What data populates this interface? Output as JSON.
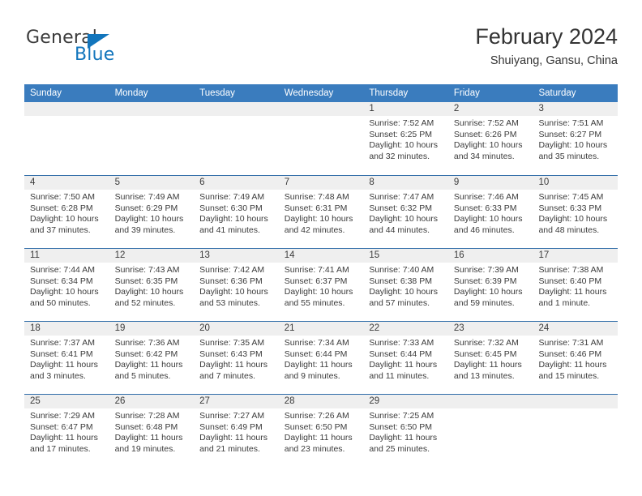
{
  "brand": {
    "name_top": "General",
    "name_bottom": "Blue",
    "accent_color": "#1275bc"
  },
  "header": {
    "title": "February 2024",
    "subtitle": "Shuiyang, Gansu, China"
  },
  "calendar": {
    "header_bg": "#3a7cbe",
    "row_divider_color": "#2f6ca8",
    "date_band_bg": "#efefef",
    "weekday_names": [
      "Sunday",
      "Monday",
      "Tuesday",
      "Wednesday",
      "Thursday",
      "Friday",
      "Saturday"
    ],
    "weeks": [
      [
        {
          "empty": true
        },
        {
          "empty": true
        },
        {
          "empty": true
        },
        {
          "empty": true
        },
        {
          "day": "1",
          "sunrise": "Sunrise: 7:52 AM",
          "sunset": "Sunset: 6:25 PM",
          "daylight": "Daylight: 10 hours and 32 minutes."
        },
        {
          "day": "2",
          "sunrise": "Sunrise: 7:52 AM",
          "sunset": "Sunset: 6:26 PM",
          "daylight": "Daylight: 10 hours and 34 minutes."
        },
        {
          "day": "3",
          "sunrise": "Sunrise: 7:51 AM",
          "sunset": "Sunset: 6:27 PM",
          "daylight": "Daylight: 10 hours and 35 minutes."
        }
      ],
      [
        {
          "day": "4",
          "sunrise": "Sunrise: 7:50 AM",
          "sunset": "Sunset: 6:28 PM",
          "daylight": "Daylight: 10 hours and 37 minutes."
        },
        {
          "day": "5",
          "sunrise": "Sunrise: 7:49 AM",
          "sunset": "Sunset: 6:29 PM",
          "daylight": "Daylight: 10 hours and 39 minutes."
        },
        {
          "day": "6",
          "sunrise": "Sunrise: 7:49 AM",
          "sunset": "Sunset: 6:30 PM",
          "daylight": "Daylight: 10 hours and 41 minutes."
        },
        {
          "day": "7",
          "sunrise": "Sunrise: 7:48 AM",
          "sunset": "Sunset: 6:31 PM",
          "daylight": "Daylight: 10 hours and 42 minutes."
        },
        {
          "day": "8",
          "sunrise": "Sunrise: 7:47 AM",
          "sunset": "Sunset: 6:32 PM",
          "daylight": "Daylight: 10 hours and 44 minutes."
        },
        {
          "day": "9",
          "sunrise": "Sunrise: 7:46 AM",
          "sunset": "Sunset: 6:33 PM",
          "daylight": "Daylight: 10 hours and 46 minutes."
        },
        {
          "day": "10",
          "sunrise": "Sunrise: 7:45 AM",
          "sunset": "Sunset: 6:33 PM",
          "daylight": "Daylight: 10 hours and 48 minutes."
        }
      ],
      [
        {
          "day": "11",
          "sunrise": "Sunrise: 7:44 AM",
          "sunset": "Sunset: 6:34 PM",
          "daylight": "Daylight: 10 hours and 50 minutes."
        },
        {
          "day": "12",
          "sunrise": "Sunrise: 7:43 AM",
          "sunset": "Sunset: 6:35 PM",
          "daylight": "Daylight: 10 hours and 52 minutes."
        },
        {
          "day": "13",
          "sunrise": "Sunrise: 7:42 AM",
          "sunset": "Sunset: 6:36 PM",
          "daylight": "Daylight: 10 hours and 53 minutes."
        },
        {
          "day": "14",
          "sunrise": "Sunrise: 7:41 AM",
          "sunset": "Sunset: 6:37 PM",
          "daylight": "Daylight: 10 hours and 55 minutes."
        },
        {
          "day": "15",
          "sunrise": "Sunrise: 7:40 AM",
          "sunset": "Sunset: 6:38 PM",
          "daylight": "Daylight: 10 hours and 57 minutes."
        },
        {
          "day": "16",
          "sunrise": "Sunrise: 7:39 AM",
          "sunset": "Sunset: 6:39 PM",
          "daylight": "Daylight: 10 hours and 59 minutes."
        },
        {
          "day": "17",
          "sunrise": "Sunrise: 7:38 AM",
          "sunset": "Sunset: 6:40 PM",
          "daylight": "Daylight: 11 hours and 1 minute."
        }
      ],
      [
        {
          "day": "18",
          "sunrise": "Sunrise: 7:37 AM",
          "sunset": "Sunset: 6:41 PM",
          "daylight": "Daylight: 11 hours and 3 minutes."
        },
        {
          "day": "19",
          "sunrise": "Sunrise: 7:36 AM",
          "sunset": "Sunset: 6:42 PM",
          "daylight": "Daylight: 11 hours and 5 minutes."
        },
        {
          "day": "20",
          "sunrise": "Sunrise: 7:35 AM",
          "sunset": "Sunset: 6:43 PM",
          "daylight": "Daylight: 11 hours and 7 minutes."
        },
        {
          "day": "21",
          "sunrise": "Sunrise: 7:34 AM",
          "sunset": "Sunset: 6:44 PM",
          "daylight": "Daylight: 11 hours and 9 minutes."
        },
        {
          "day": "22",
          "sunrise": "Sunrise: 7:33 AM",
          "sunset": "Sunset: 6:44 PM",
          "daylight": "Daylight: 11 hours and 11 minutes."
        },
        {
          "day": "23",
          "sunrise": "Sunrise: 7:32 AM",
          "sunset": "Sunset: 6:45 PM",
          "daylight": "Daylight: 11 hours and 13 minutes."
        },
        {
          "day": "24",
          "sunrise": "Sunrise: 7:31 AM",
          "sunset": "Sunset: 6:46 PM",
          "daylight": "Daylight: 11 hours and 15 minutes."
        }
      ],
      [
        {
          "day": "25",
          "sunrise": "Sunrise: 7:29 AM",
          "sunset": "Sunset: 6:47 PM",
          "daylight": "Daylight: 11 hours and 17 minutes."
        },
        {
          "day": "26",
          "sunrise": "Sunrise: 7:28 AM",
          "sunset": "Sunset: 6:48 PM",
          "daylight": "Daylight: 11 hours and 19 minutes."
        },
        {
          "day": "27",
          "sunrise": "Sunrise: 7:27 AM",
          "sunset": "Sunset: 6:49 PM",
          "daylight": "Daylight: 11 hours and 21 minutes."
        },
        {
          "day": "28",
          "sunrise": "Sunrise: 7:26 AM",
          "sunset": "Sunset: 6:50 PM",
          "daylight": "Daylight: 11 hours and 23 minutes."
        },
        {
          "day": "29",
          "sunrise": "Sunrise: 7:25 AM",
          "sunset": "Sunset: 6:50 PM",
          "daylight": "Daylight: 11 hours and 25 minutes."
        },
        {
          "empty": true
        },
        {
          "empty": true
        }
      ]
    ]
  }
}
